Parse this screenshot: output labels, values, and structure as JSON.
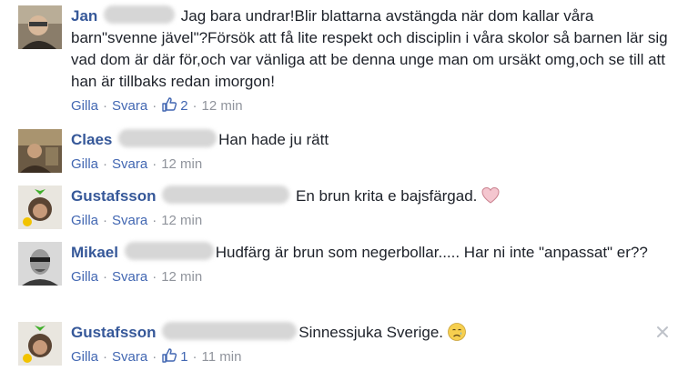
{
  "comments": [
    {
      "author": "Jan",
      "text": "Jag bara undrar!Blir blattarna avstängda när dom kallar våra barn\"svenne jävel\"?Försök att få lite respekt och disciplin i våra skolor så barnen lär sig vad dom är där för,och var vänliga att be denna unge man om ursäkt omg,och se till att han är tillbaks redan imorgon!",
      "like_label": "Gilla",
      "reply_label": "Svara",
      "likes": "2",
      "time": "12 min"
    },
    {
      "author": "Claes",
      "text": "Han hade ju rätt",
      "like_label": "Gilla",
      "reply_label": "Svara",
      "time": "12 min"
    },
    {
      "author": "Gustafsson",
      "text": "En brun krita e bajsfärgad.",
      "emoji": "pink-heart-icon",
      "like_label": "Gilla",
      "reply_label": "Svara",
      "time": "12 min"
    },
    {
      "author": "Mikael",
      "text": "Hudfärg är brun som negerbollar..... Har ni inte \"anpassat\" er??",
      "like_label": "Gilla",
      "reply_label": "Svara",
      "time": "12 min"
    },
    {
      "author": "Gustafsson",
      "text": "Sinnessjuka Sverige.",
      "emoji": "crying-face-icon",
      "like_label": "Gilla",
      "reply_label": "Svara",
      "likes": "1",
      "time": "11 min"
    }
  ],
  "colors": {
    "author": "#365899",
    "link": "#4267b2",
    "meta": "#90949c",
    "text": "#1d2129"
  }
}
